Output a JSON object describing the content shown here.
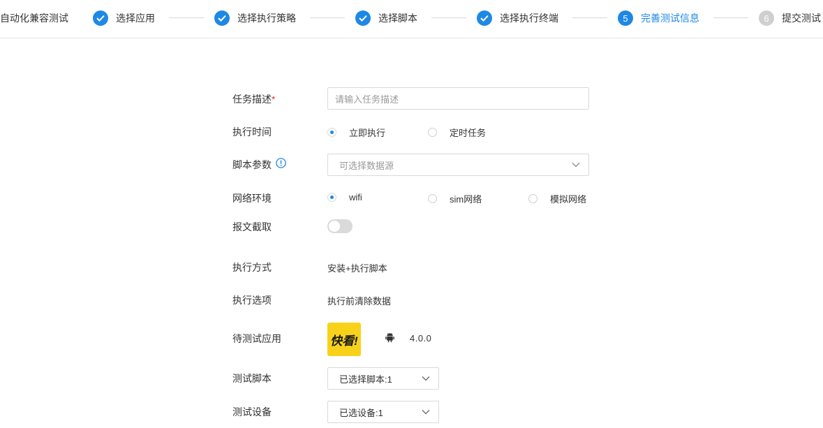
{
  "page_title": "自动化兼容测试",
  "steps": [
    {
      "label": "选择应用",
      "status": "done"
    },
    {
      "label": "选择执行策略",
      "status": "done"
    },
    {
      "label": "选择脚本",
      "status": "done"
    },
    {
      "label": "选择执行终端",
      "status": "done"
    },
    {
      "label": "完善测试信息",
      "status": "active",
      "number": "5"
    },
    {
      "label": "提交测试",
      "status": "todo",
      "number": "6"
    }
  ],
  "form": {
    "task_desc": {
      "label": "任务描述",
      "required_mark": "*",
      "placeholder": "请输入任务描述"
    },
    "exec_time": {
      "label": "执行时间",
      "options": [
        "立即执行",
        "定时任务"
      ],
      "selected": "立即执行"
    },
    "script_params": {
      "label": "脚本参数",
      "placeholder": "可选择数据源",
      "info_icon": "info-icon"
    },
    "network": {
      "label": "网络环境",
      "options": [
        "wifi",
        "sim网络",
        "模拟网络"
      ],
      "selected": "wifi"
    },
    "capture": {
      "label": "报文截取",
      "enabled": false
    },
    "exec_mode": {
      "label": "执行方式",
      "value": "安装+执行脚本"
    },
    "exec_option": {
      "label": "执行选项",
      "value": "执行前清除数据"
    },
    "app": {
      "label": "待测试应用",
      "icon_text": "快看!",
      "platform_icon": "android-icon",
      "version": "4.0.0"
    },
    "test_script": {
      "label": "测试脚本",
      "value": "已选择脚本:1"
    },
    "test_device": {
      "label": "测试设备",
      "value": "已选设备:1"
    }
  },
  "colors": {
    "accent": "#1e88e5",
    "required": "#e53935",
    "app_icon_bg": "#f8d21a"
  }
}
